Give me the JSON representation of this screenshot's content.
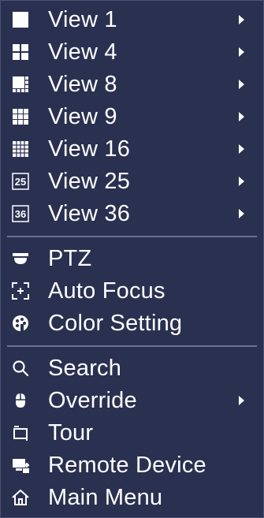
{
  "menu": {
    "items": [
      {
        "label": "View 1",
        "icon": "view-1-icon"
      },
      {
        "label": "View 4",
        "icon": "view-4-icon"
      },
      {
        "label": "View 8",
        "icon": "view-8-icon"
      },
      {
        "label": "View 9",
        "icon": "view-9-icon"
      },
      {
        "label": "View 16",
        "icon": "view-16-icon"
      },
      {
        "label": "View 25",
        "icon": "view-25-icon",
        "icon_text": "25"
      },
      {
        "label": "View 36",
        "icon": "view-36-icon",
        "icon_text": "36"
      },
      {
        "label": "PTZ",
        "icon": "ptz-camera-icon"
      },
      {
        "label": "Auto Focus",
        "icon": "auto-focus-icon"
      },
      {
        "label": "Color Setting",
        "icon": "color-palette-icon"
      },
      {
        "label": "Search",
        "icon": "search-icon"
      },
      {
        "label": "Override",
        "icon": "mouse-icon"
      },
      {
        "label": "Tour",
        "icon": "tour-loop-icon"
      },
      {
        "label": "Remote Device",
        "icon": "remote-device-icon"
      },
      {
        "label": "Main Menu",
        "icon": "home-icon"
      }
    ]
  },
  "colors": {
    "background": "#2a3050",
    "text": "#ffffff",
    "separator": "#6a7092"
  }
}
